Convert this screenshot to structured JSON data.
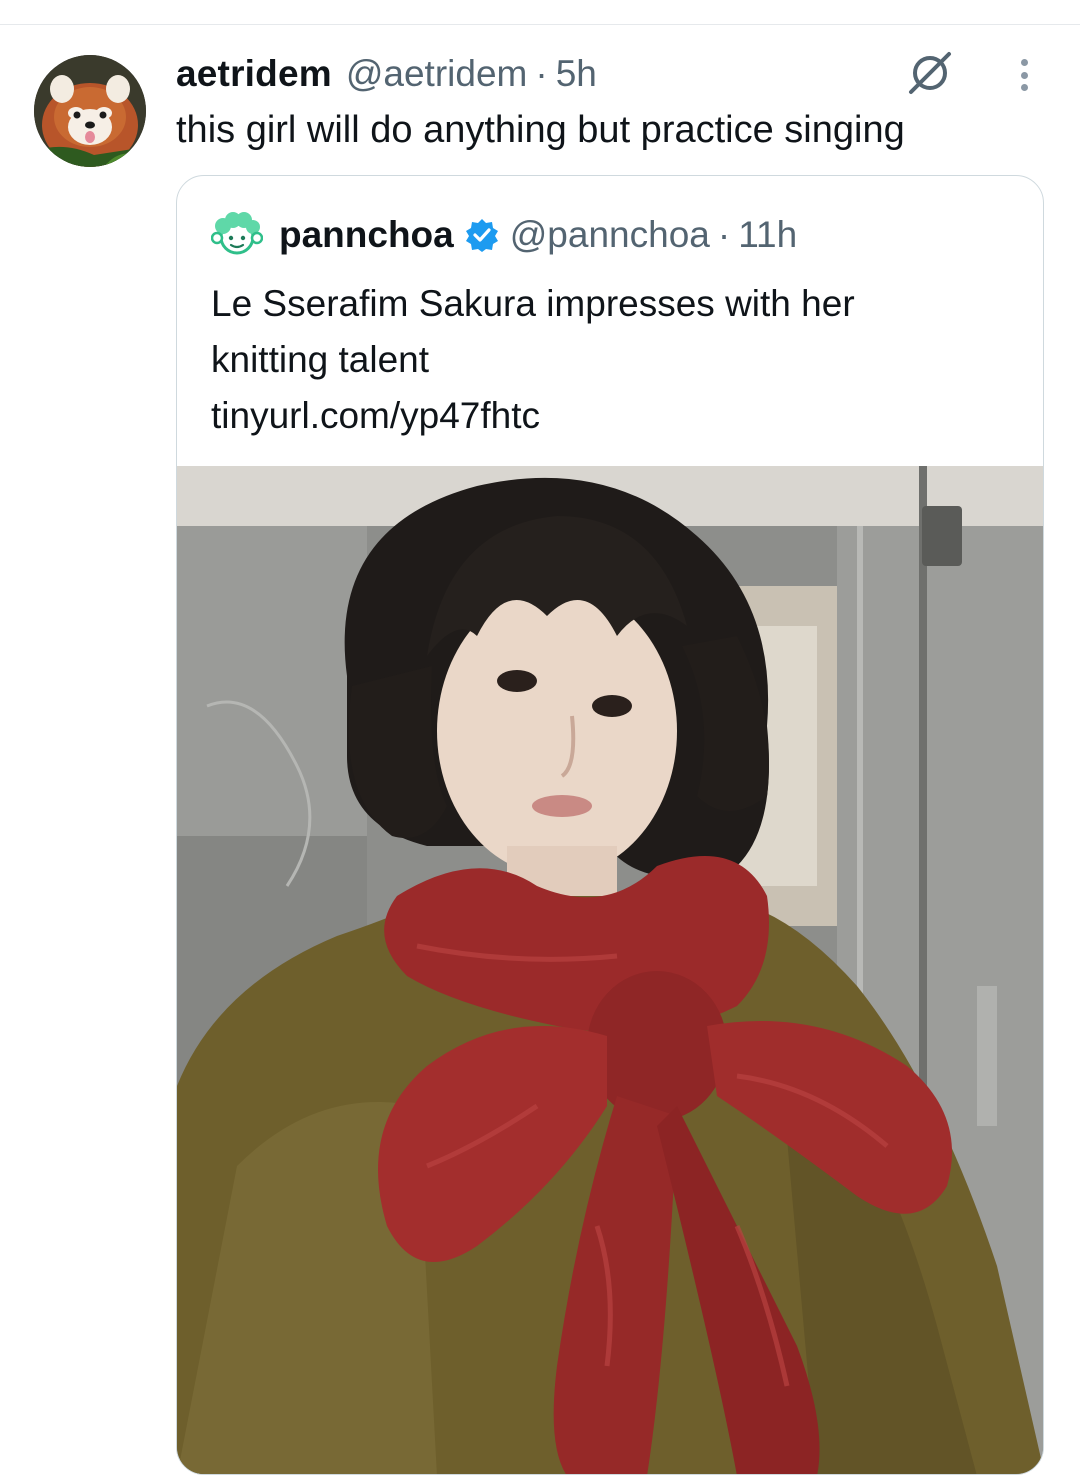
{
  "tweet": {
    "display_name": "aetridem",
    "handle": "@aetridem",
    "separator": "·",
    "time": "5h",
    "text": "this girl will do anything but practice singing",
    "avatar_icon": "red-panda-avatar",
    "actions": {
      "grok_icon": "grok-icon",
      "more_icon": "more-options-icon"
    }
  },
  "quoted_tweet": {
    "display_name": "pannchoa",
    "verified": true,
    "handle": "@pannchoa",
    "separator": "·",
    "time": "11h",
    "text_line_1": "Le Sserafim Sakura impresses with her",
    "text_line_2": "knitting talent",
    "link": "tinyurl.com/yp47fhtc",
    "avatar_icon": "green-cartoon-avatar",
    "media": "photo-woman-with-red-knitted-bow-scarf"
  },
  "colors": {
    "text": "#0f1419",
    "secondary": "#536471",
    "border": "#cfd9de",
    "verified_blue": "#1d9bf0",
    "scarf_red": "#9e2b2b",
    "coat_olive": "#6e5f2c"
  }
}
